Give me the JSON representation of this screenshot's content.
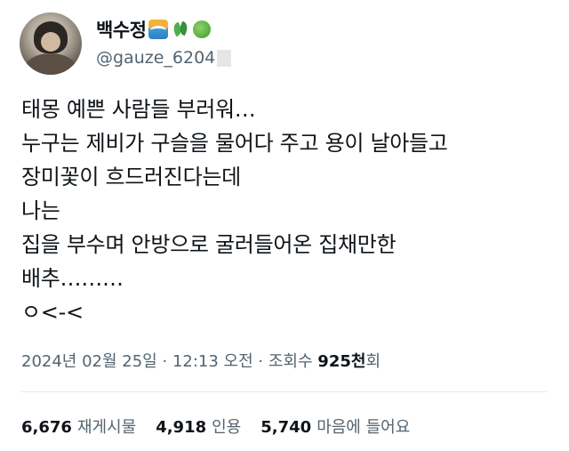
{
  "user": {
    "display_name": "백수정",
    "emojis": [
      "wave-emoji",
      "herb-emoji",
      "yarn-emoji"
    ],
    "handle": "@gauze_6204"
  },
  "tweet": {
    "lines": [
      "태몽 예쁜 사람들 부러워…",
      "누구는 제비가 구슬을 물어다 주고 용이 날아들고",
      "장미꽃이 흐드러진다는데",
      "나는",
      "집을 부수며 안방으로 굴러들어온 집채만한",
      "배추………",
      "ㅇ<-<"
    ]
  },
  "meta": {
    "date": "2024년 02월 25일",
    "separator": "·",
    "time": "12:13 오전",
    "views_label": "조회수",
    "views_count": "925천",
    "views_suffix": "회"
  },
  "stats": [
    {
      "count": "6,676",
      "label": "재게시물"
    },
    {
      "count": "4,918",
      "label": "인용"
    },
    {
      "count": "5,740",
      "label": "마음에 들어요"
    }
  ]
}
